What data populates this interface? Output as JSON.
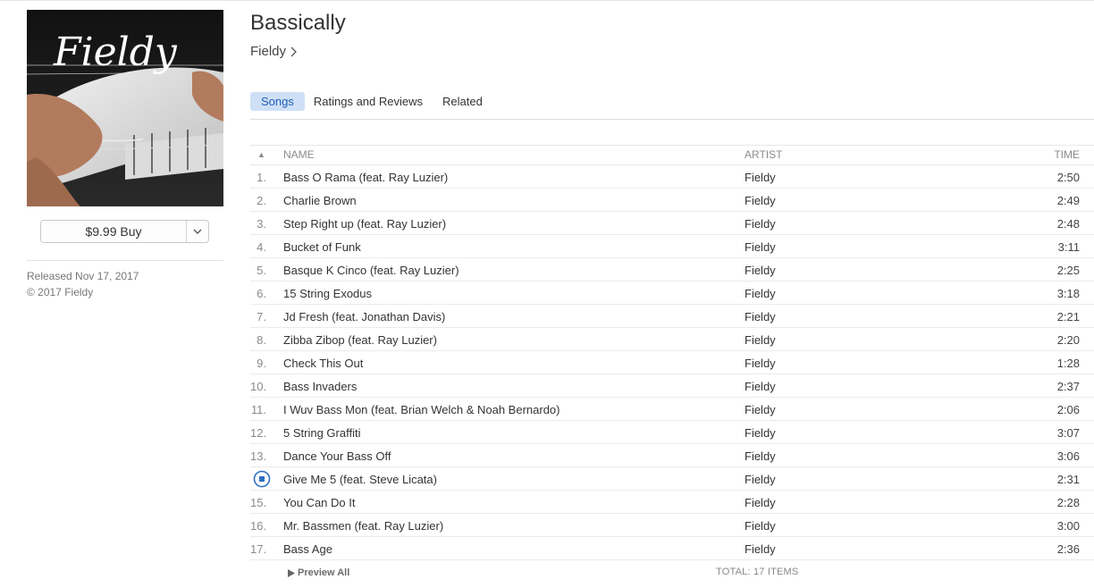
{
  "album": {
    "title": "Bassically",
    "artist": "Fieldy",
    "art_text": "Fieldy",
    "price_button": "$9.99 Buy",
    "released": "Released Nov 17, 2017",
    "copyright": "© 2017 Fieldy"
  },
  "tabs": [
    {
      "label": "Songs",
      "active": true
    },
    {
      "label": "Ratings and Reviews",
      "active": false
    },
    {
      "label": "Related",
      "active": false
    }
  ],
  "table": {
    "headers": {
      "num": "▲",
      "name": "NAME",
      "artist": "ARTIST",
      "time": "TIME"
    },
    "rows": [
      {
        "num": "1.",
        "name": "Bass O Rama (feat. Ray Luzier)",
        "artist": "Fieldy",
        "time": "2:50"
      },
      {
        "num": "2.",
        "name": "Charlie Brown",
        "artist": "Fieldy",
        "time": "2:49"
      },
      {
        "num": "3.",
        "name": "Step Right up (feat. Ray Luzier)",
        "artist": "Fieldy",
        "time": "2:48"
      },
      {
        "num": "4.",
        "name": "Bucket of Funk",
        "artist": "Fieldy",
        "time": "3:11"
      },
      {
        "num": "5.",
        "name": "Basque K Cinco (feat. Ray Luzier)",
        "artist": "Fieldy",
        "time": "2:25"
      },
      {
        "num": "6.",
        "name": "15 String Exodus",
        "artist": "Fieldy",
        "time": "3:18"
      },
      {
        "num": "7.",
        "name": "Jd Fresh (feat. Jonathan Davis)",
        "artist": "Fieldy",
        "time": "2:21"
      },
      {
        "num": "8.",
        "name": "Zibba Zibop (feat. Ray Luzier)",
        "artist": "Fieldy",
        "time": "2:20"
      },
      {
        "num": "9.",
        "name": "Check This Out",
        "artist": "Fieldy",
        "time": "1:28"
      },
      {
        "num": "10.",
        "name": "Bass Invaders",
        "artist": "Fieldy",
        "time": "2:37"
      },
      {
        "num": "11.",
        "name": "I Wuv Bass Mon (feat. Brian Welch & Noah Bernardo)",
        "artist": "Fieldy",
        "time": "2:06"
      },
      {
        "num": "12.",
        "name": "5 String Graffiti",
        "artist": "Fieldy",
        "time": "3:07"
      },
      {
        "num": "13.",
        "name": "Dance Your Bass Off",
        "artist": "Fieldy",
        "time": "3:06"
      },
      {
        "num": "",
        "name": "Give Me 5 (feat. Steve Licata)",
        "artist": "Fieldy",
        "time": "2:31",
        "playing": true
      },
      {
        "num": "15.",
        "name": "You Can Do It",
        "artist": "Fieldy",
        "time": "2:28"
      },
      {
        "num": "16.",
        "name": "Mr. Bassmen (feat. Ray Luzier)",
        "artist": "Fieldy",
        "time": "3:00"
      },
      {
        "num": "17.",
        "name": "Bass Age",
        "artist": "Fieldy",
        "time": "2:36"
      }
    ],
    "preview_all": "Preview All",
    "total": "TOTAL: 17 ITEMS"
  },
  "colors": {
    "accent": "#1f5fb4",
    "tab_active_bg": "#cfe0f6",
    "playing_icon": "#2e6fc4"
  }
}
